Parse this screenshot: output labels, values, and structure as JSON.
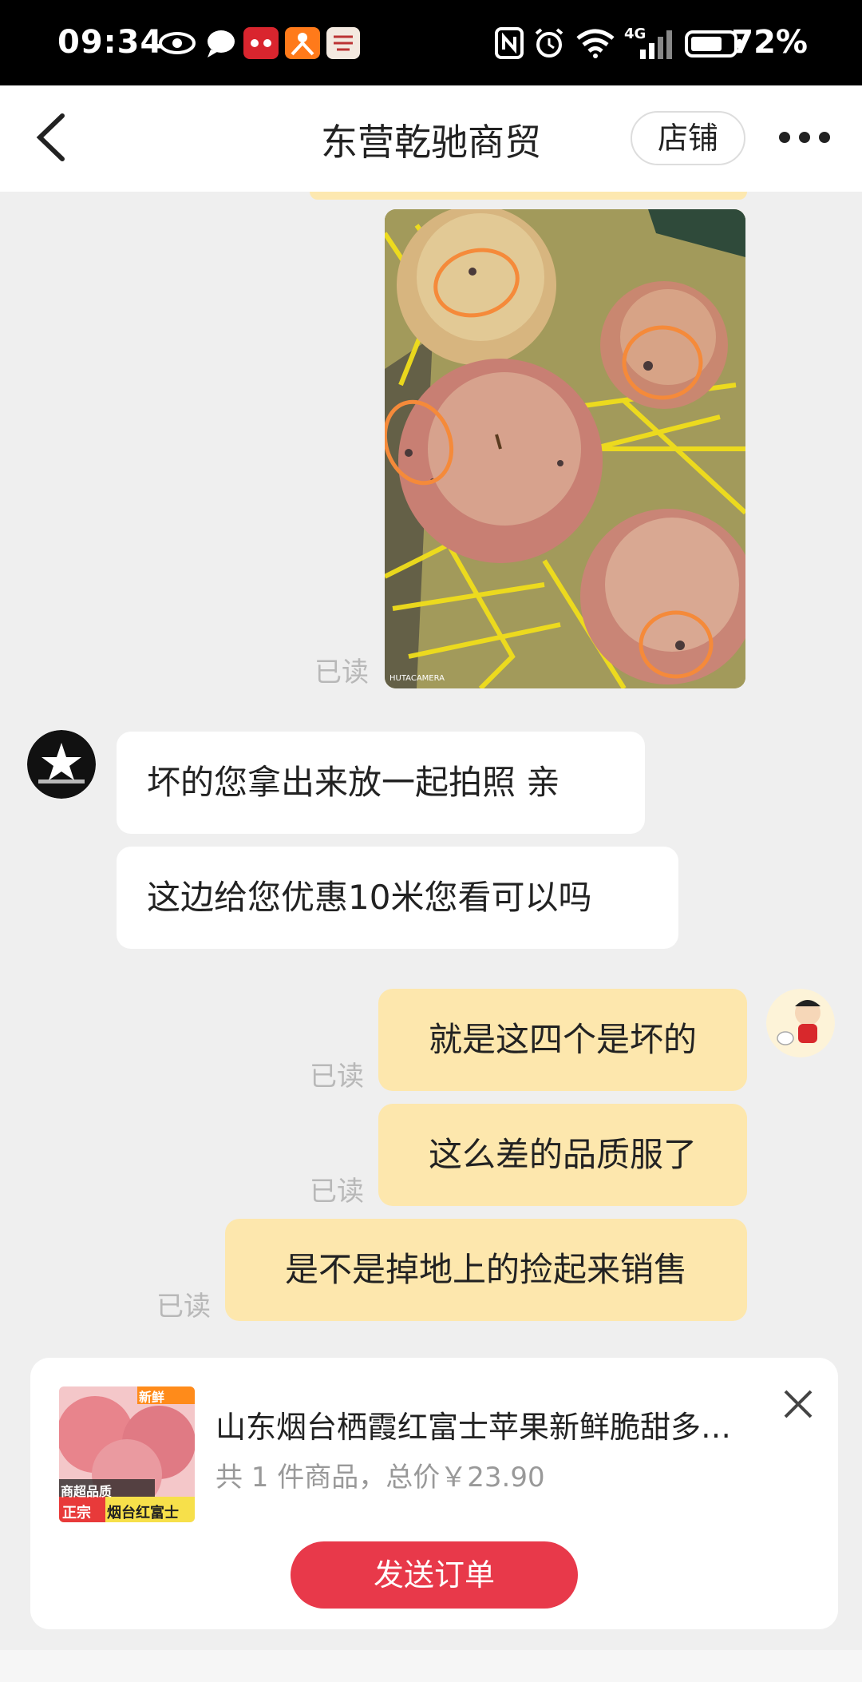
{
  "status_bar": {
    "time": "09:34",
    "battery": "72%",
    "network": "4G",
    "icons": [
      "eye-icon",
      "chat-icon",
      "tmall-icon",
      "app-icon",
      "wu-icon",
      "nfc-icon",
      "alarm-icon",
      "wifi-icon",
      "signal-icon",
      "battery-icon"
    ]
  },
  "nav": {
    "title": "东营乾驰商贸",
    "shop_label": "店铺"
  },
  "messages": {
    "photo_read": "已读",
    "seller_msg_1": "坏的您拿出来放一起拍照 亲",
    "seller_msg_2": "这边给您优惠10米您看可以吗",
    "buyer_msg_1": "就是这四个是坏的",
    "buyer_msg_1_read": "已读",
    "buyer_msg_2": "这么差的品质服了",
    "buyer_msg_2_read": "已读",
    "buyer_msg_3": "是不是掉地上的捡起来销售",
    "buyer_msg_3_read": "已读"
  },
  "order": {
    "badge_new": "新鲜",
    "label_quality": "商超品质",
    "label_genuine": "正宗",
    "label_origin": "烟台红富士",
    "title": "山东烟台栖霞红富士苹果新鲜脆甜多…",
    "summary": "共 1 件商品，总价￥23.90",
    "send_label": "发送订单"
  },
  "colors": {
    "bubble_self": "#fde7ad",
    "bubble_other": "#ffffff",
    "accent": "#e8394a",
    "chat_bg": "#efefef"
  }
}
